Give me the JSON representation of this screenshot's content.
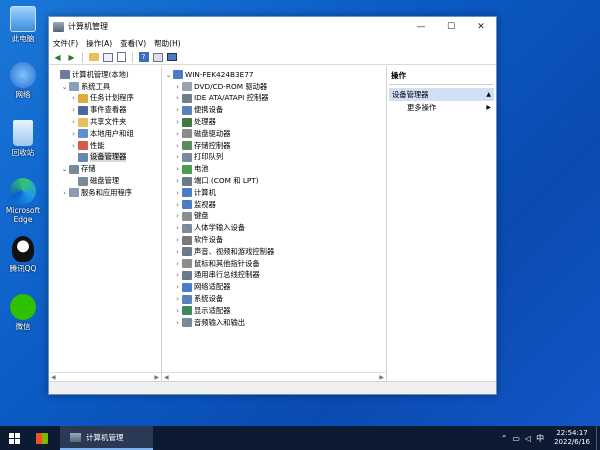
{
  "desktop": {
    "icons": [
      {
        "label": "此电脑",
        "icon": "computer-icon"
      },
      {
        "label": "网络",
        "icon": "network-icon"
      },
      {
        "label": "回收站",
        "icon": "recycle-bin-icon"
      },
      {
        "label": "Microsoft Edge",
        "icon": "edge-icon"
      },
      {
        "label": "腾讯QQ",
        "icon": "qq-icon"
      },
      {
        "label": "微信",
        "icon": "wechat-icon"
      }
    ]
  },
  "window": {
    "title": "计算机管理",
    "minimize": "—",
    "maximize": "☐",
    "close": "✕"
  },
  "menubar": {
    "file": "文件(F)",
    "action": "操作(A)",
    "view": "查看(V)",
    "help": "帮助(H)"
  },
  "left_tree": [
    {
      "label": "计算机管理(本地)",
      "exp": "",
      "indent": 0,
      "color": "#6b7d99"
    },
    {
      "label": "系统工具",
      "exp": "⌄",
      "indent": 1,
      "color": "#8aa0b8"
    },
    {
      "label": "任务计划程序",
      "exp": "›",
      "indent": 2,
      "color": "#e0a93a"
    },
    {
      "label": "事件查看器",
      "exp": "›",
      "indent": 2,
      "color": "#4b6a9b"
    },
    {
      "label": "共享文件夹",
      "exp": "›",
      "indent": 2,
      "color": "#e6c15a"
    },
    {
      "label": "本地用户和组",
      "exp": "›",
      "indent": 2,
      "color": "#5b8fd1"
    },
    {
      "label": "性能",
      "exp": "›",
      "indent": 2,
      "color": "#d65a4a"
    },
    {
      "label": "设备管理器",
      "exp": "",
      "indent": 2,
      "color": "#6b87b0",
      "selected": true
    },
    {
      "label": "存储",
      "exp": "⌄",
      "indent": 1,
      "color": "#7b8a9a"
    },
    {
      "label": "磁盘管理",
      "exp": "",
      "indent": 2,
      "color": "#7b8a9a"
    },
    {
      "label": "服务和应用程序",
      "exp": "›",
      "indent": 1,
      "color": "#8a9bb0"
    }
  ],
  "device_tree": {
    "root": "WIN-FEK424B3E77",
    "items": [
      {
        "label": "DVD/CD-ROM 驱动器",
        "color": "#9aa3ad"
      },
      {
        "label": "IDE ATA/ATAPI 控制器",
        "color": "#6f7f90"
      },
      {
        "label": "便携设备",
        "color": "#5b7fb8"
      },
      {
        "label": "处理器",
        "color": "#3d7a3d"
      },
      {
        "label": "磁盘驱动器",
        "color": "#8c8c8c"
      },
      {
        "label": "存储控制器",
        "color": "#5e8a5e"
      },
      {
        "label": "打印队列",
        "color": "#7a8a9a"
      },
      {
        "label": "电池",
        "color": "#4e9a4e"
      },
      {
        "label": "端口 (COM 和 LPT)",
        "color": "#6a7a8a"
      },
      {
        "label": "计算机",
        "color": "#4b7cc4"
      },
      {
        "label": "监视器",
        "color": "#4b7cc4"
      },
      {
        "label": "键盘",
        "color": "#8c8c8c"
      },
      {
        "label": "人体学输入设备",
        "color": "#7a8a9a"
      },
      {
        "label": "软件设备",
        "color": "#7a7a7a"
      },
      {
        "label": "声音、视频和游戏控制器",
        "color": "#6a7a8a"
      },
      {
        "label": "鼠标和其他指针设备",
        "color": "#8c8c8c"
      },
      {
        "label": "通用串行总线控制器",
        "color": "#6a7a8a"
      },
      {
        "label": "网络适配器",
        "color": "#4b7cc4"
      },
      {
        "label": "系统设备",
        "color": "#5b7fb8"
      },
      {
        "label": "显示适配器",
        "color": "#3d8a5a"
      },
      {
        "label": "音频输入和输出",
        "color": "#7a8a9a"
      }
    ]
  },
  "actions": {
    "header": "操作",
    "group": "设备管理器",
    "more": "更多操作"
  },
  "taskbar": {
    "app_label": "计算机管理",
    "time": "22:54:17",
    "date": "2022/6/16"
  },
  "colors": {
    "accent": "#0a64d2",
    "selection": "#cfe0f5"
  }
}
